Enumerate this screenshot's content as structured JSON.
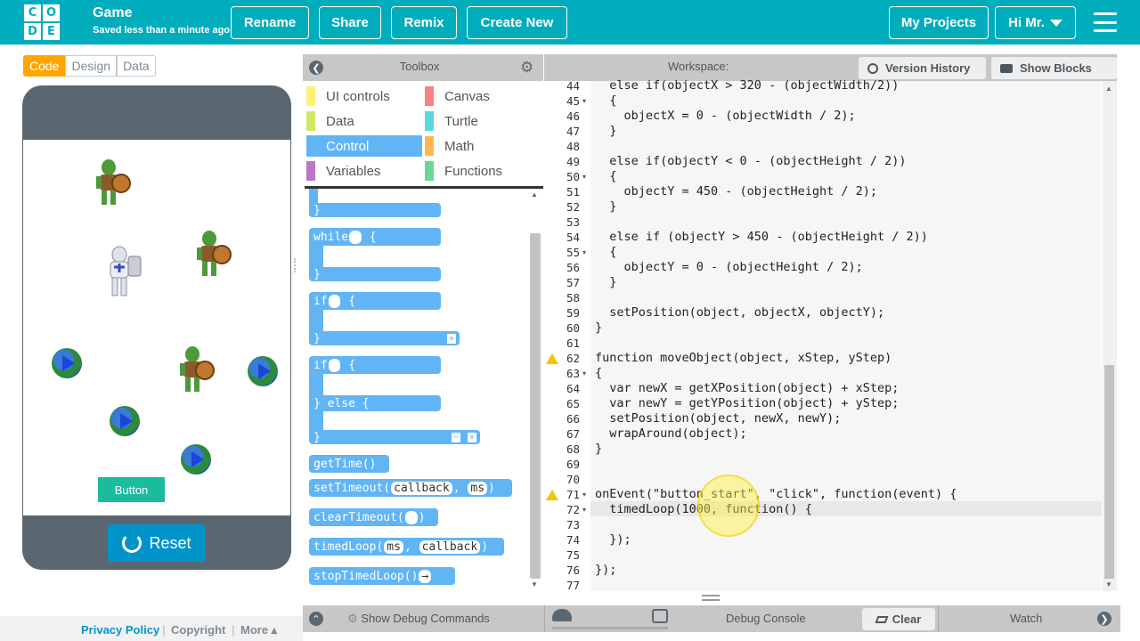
{
  "header": {
    "logo_letters": [
      "C",
      "O",
      "D",
      "E"
    ],
    "project_title": "Game",
    "save_status": "Saved less than a minute ago",
    "buttons": {
      "rename": "Rename",
      "share": "Share",
      "remix": "Remix",
      "create_new": "Create New",
      "my_projects": "My Projects",
      "user": "Hi Mr."
    },
    "colors": {
      "bar": "#00adbc"
    }
  },
  "mode_tabs": [
    "Code",
    "Design",
    "Data"
  ],
  "app": {
    "button_label": "Button",
    "reset_label": "Reset"
  },
  "footer": {
    "privacy": "Privacy Policy",
    "copyright": "Copyright",
    "more": "More"
  },
  "toolbox": {
    "title": "Toolbox",
    "categories": [
      {
        "label": "UI controls",
        "color": "#fff176"
      },
      {
        "label": "Canvas",
        "color": "#f78183"
      },
      {
        "label": "Data",
        "color": "#d3e965"
      },
      {
        "label": "Turtle",
        "color": "#59d8e0"
      },
      {
        "label": "Control",
        "color": "#64b5f6"
      },
      {
        "label": "Math",
        "color": "#ffb74d"
      },
      {
        "label": "Variables",
        "color": "#bb77c7"
      },
      {
        "label": "Functions",
        "color": "#68d995"
      }
    ],
    "blocks": {
      "while": "while",
      "if1": "if",
      "if2": "if",
      "else": "} else {",
      "getTime": "getTime()",
      "setTimeout": "setTimeout(",
      "setTimeout_args": [
        "callback",
        "ms"
      ],
      "clearTimeout": "clearTimeout(",
      "timedLoop": "timedLoop(",
      "timedLoop_args": [
        "ms",
        "callback"
      ],
      "stopTimedLoop": "stopTimedLoop()"
    }
  },
  "workspace": {
    "title": "Workspace:",
    "version_history": "Version History",
    "show_blocks": "Show Blocks",
    "lines": [
      {
        "n": "44",
        "text": "  else if(objectX > 320 - (objectWidth/2))"
      },
      {
        "n": "45",
        "text": "  {",
        "fold": true
      },
      {
        "n": "46",
        "text": "    objectX = 0 - (objectWidth / 2);"
      },
      {
        "n": "47",
        "text": "  }"
      },
      {
        "n": "48",
        "text": ""
      },
      {
        "n": "49",
        "text": "  else if(objectY < 0 - (objectHeight / 2))"
      },
      {
        "n": "50",
        "text": "  {",
        "fold": true
      },
      {
        "n": "51",
        "text": "    objectY = 450 - (objectHeight / 2);"
      },
      {
        "n": "52",
        "text": "  }"
      },
      {
        "n": "53",
        "text": ""
      },
      {
        "n": "54",
        "text": "  else if (objectY > 450 - (objectHeight / 2))"
      },
      {
        "n": "55",
        "text": "  {",
        "fold": true
      },
      {
        "n": "56",
        "text": "    objectY = 0 - (objectHeight / 2);"
      },
      {
        "n": "57",
        "text": "  }"
      },
      {
        "n": "58",
        "text": ""
      },
      {
        "n": "59",
        "text": "  setPosition(object, objectX, objectY);"
      },
      {
        "n": "60",
        "text": "}"
      },
      {
        "n": "61",
        "text": ""
      },
      {
        "n": "62",
        "text": "function moveObject(object, xStep, yStep)",
        "warn": true
      },
      {
        "n": "63",
        "text": "{",
        "fold": true
      },
      {
        "n": "64",
        "text": "  var newX = getXPosition(object) + xStep;"
      },
      {
        "n": "65",
        "text": "  var newY = getYPosition(object) + yStep;"
      },
      {
        "n": "66",
        "text": "  setPosition(object, newX, newY);"
      },
      {
        "n": "67",
        "text": "  wrapAround(object);"
      },
      {
        "n": "68",
        "text": "}"
      },
      {
        "n": "69",
        "text": ""
      },
      {
        "n": "70",
        "text": ""
      },
      {
        "n": "71",
        "text": "onEvent(\"button_start\", \"click\", function(event) {",
        "warn": true,
        "fold": true
      },
      {
        "n": "72",
        "text": "  timedLoop(1000, function() {",
        "fold": true
      },
      {
        "n": "73",
        "text": ""
      },
      {
        "n": "74",
        "text": "  });"
      },
      {
        "n": "75",
        "text": ""
      },
      {
        "n": "76",
        "text": "});"
      },
      {
        "n": "77",
        "text": ""
      }
    ]
  },
  "bottom": {
    "show_debug": "Show Debug Commands",
    "debug_console": "Debug Console",
    "clear": "Clear",
    "watch": "Watch"
  }
}
